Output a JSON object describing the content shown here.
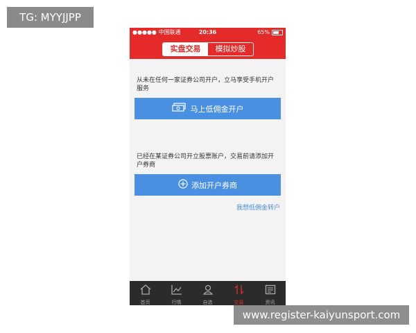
{
  "overlay": {
    "tag": "TG: MYYJJPP",
    "watermark": "www.register-kaiyunsport.com"
  },
  "status": {
    "carrier": "●●●●● 中国联通",
    "time": "20:36",
    "battery": "65%"
  },
  "nav": {
    "tab_real": "实盘交易",
    "tab_sim": "模拟炒股"
  },
  "main": {
    "intro_new": "从未在任何一家证券公司开户，立马享受手机开户服务",
    "btn_open": "马上低佣金开户",
    "intro_existing": "已经在某证券公司开立股票账户，交易前请添加开户券商",
    "btn_add": "添加开户券商",
    "link_transfer": "我想低佣金转户"
  },
  "tabs": [
    {
      "label": "首页",
      "icon": "home-icon",
      "active": false
    },
    {
      "label": "行情",
      "icon": "chart-icon",
      "active": false
    },
    {
      "label": "自选",
      "icon": "person-icon",
      "active": false
    },
    {
      "label": "交易",
      "icon": "trade-icon",
      "active": true
    },
    {
      "label": "资讯",
      "icon": "news-icon",
      "active": false
    }
  ],
  "colors": {
    "brand_red": "#e52a2a",
    "button_blue": "#4a90e2",
    "tabbar": "#2b2b2b"
  }
}
